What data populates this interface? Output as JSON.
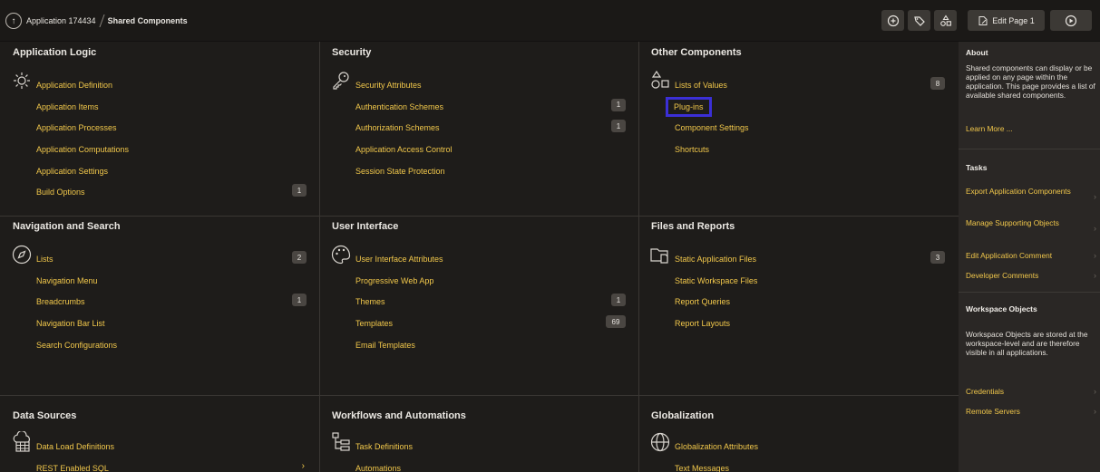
{
  "topbar": {
    "app": "Application 174434",
    "current": "Shared Components",
    "edit_page": "Edit Page 1"
  },
  "panels": [
    {
      "title": "Application Logic",
      "icon": "gears-icon",
      "items": [
        {
          "label": "Application Definition"
        },
        {
          "label": "Application Items"
        },
        {
          "label": "Application Processes"
        },
        {
          "label": "Application Computations"
        },
        {
          "label": "Application Settings"
        },
        {
          "label": "Build Options",
          "badge": "1"
        }
      ]
    },
    {
      "title": "Security",
      "icon": "key-icon",
      "items": [
        {
          "label": "Security Attributes"
        },
        {
          "label": "Authentication Schemes",
          "badge": "1"
        },
        {
          "label": "Authorization Schemes",
          "badge": "1"
        },
        {
          "label": "Application Access Control"
        },
        {
          "label": "Session State Protection"
        }
      ]
    },
    {
      "title": "Other Components",
      "icon": "shapes-icon",
      "items": [
        {
          "label": "Lists of Values",
          "badge": "8"
        },
        {
          "label": "Plug-ins",
          "highlighted": true
        },
        {
          "label": "Component Settings"
        },
        {
          "label": "Shortcuts"
        }
      ]
    },
    {
      "title": "Navigation and Search",
      "icon": "compass-icon",
      "items": [
        {
          "label": "Lists",
          "badge": "2"
        },
        {
          "label": "Navigation Menu"
        },
        {
          "label": "Breadcrumbs",
          "badge": "1"
        },
        {
          "label": "Navigation Bar List"
        },
        {
          "label": "Search Configurations"
        }
      ]
    },
    {
      "title": "User Interface",
      "icon": "palette-icon",
      "items": [
        {
          "label": "User Interface Attributes"
        },
        {
          "label": "Progressive Web App"
        },
        {
          "label": "Themes",
          "badge": "1"
        },
        {
          "label": "Templates",
          "badge": "69"
        },
        {
          "label": "Email Templates"
        }
      ]
    },
    {
      "title": "Files and Reports",
      "icon": "folder-file-icon",
      "items": [
        {
          "label": "Static Application Files",
          "badge": "3"
        },
        {
          "label": "Static Workspace Files"
        },
        {
          "label": "Report Queries"
        },
        {
          "label": "Report Layouts"
        }
      ]
    },
    {
      "title": "Data Sources",
      "icon": "cloud-table-icon",
      "items": [
        {
          "label": "Data Load Definitions"
        },
        {
          "label": "REST Enabled SQL",
          "chevron": true
        }
      ]
    },
    {
      "title": "Workflows and Automations",
      "icon": "workflow-icon",
      "items": [
        {
          "label": "Task Definitions"
        },
        {
          "label": "Automations"
        }
      ]
    },
    {
      "title": "Globalization",
      "icon": "globe-icon",
      "items": [
        {
          "label": "Globalization Attributes"
        },
        {
          "label": "Text Messages"
        }
      ]
    }
  ],
  "sidebar": {
    "about_title": "About",
    "about_text": "Shared components can display or be applied on any page within the application. This page provides a list of available shared components.",
    "learn_more": "Learn More ...",
    "tasks_title": "Tasks",
    "tasks": [
      {
        "label": "Export Application Components"
      },
      {
        "label": "Manage Supporting Objects"
      },
      {
        "label": "Edit Application Comment"
      },
      {
        "label": "Developer Comments"
      }
    ],
    "workspace_title": "Workspace Objects",
    "workspace_text": "Workspace Objects are stored at the workspace-level and are therefore visible in all applications.",
    "workspace_links": [
      {
        "label": "Credentials"
      },
      {
        "label": "Remote Servers"
      }
    ]
  },
  "colors": {
    "link": "#f2c84b",
    "highlight": "#3b2fd6",
    "background": "#1e1c1a"
  }
}
